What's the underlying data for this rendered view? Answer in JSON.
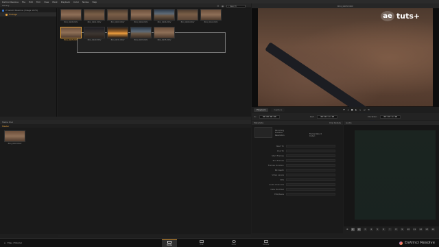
{
  "menubar": {
    "items": [
      "DaVinci Resolve",
      "File",
      "Edit",
      "Trim",
      "View",
      "Mark",
      "Playback",
      "Color",
      "Nodes",
      "Help"
    ]
  },
  "library": {
    "header": "Library",
    "tree": [
      {
        "label": "2 Seoni4 Resolve (Image 1970)",
        "selected": false
      },
      {
        "label": "Footage",
        "selected": true
      }
    ],
    "search_placeholder": "Search",
    "clips_row1": [
      "BV4_0028.MOV",
      "BV4_0001.MOV",
      "BV4_0003.MOV",
      "BV4_0004.MOV",
      "BV4_0006.MOV",
      "BV4_0008.MOV",
      "BV4_0011.MOV"
    ],
    "clips_row2": [
      "BV4_0025.MOV",
      "BV4_0029.MOV",
      "BV4_0031.MOV",
      "BV4_0033.MOV",
      "BV4_0035.MOV"
    ]
  },
  "viewer": {
    "title": "BV4_0005.MOV",
    "tabs": [
      "Playback",
      "Capture"
    ],
    "in_label": "In:",
    "in_tc": "00:00:00:00",
    "out_label": "Out:",
    "out_tc": "00:00:11:00",
    "duration_label": "Duration:",
    "duration_tc": "00:00:11:00",
    "logo_ae": "ae",
    "logo_tuts": "tuts+"
  },
  "media_pool": {
    "header": "Media Pool",
    "bin": "Master",
    "clip_label": "BV4_0005.MOV"
  },
  "metadata": {
    "header": "Metadata",
    "mode": "Clip Details",
    "info": [
      "Recording",
      "Duration",
      "Resolution"
    ],
    "frame_rate_label": "Frame Rate: 0",
    "codec_label": "Codec:",
    "rows": [
      "Start TC",
      "End TC",
      "Start Frames",
      "End Frames",
      "Frames Duration",
      "Bit Depth",
      "Video Levels",
      "VDS",
      "Audio Channels",
      "Date Modified",
      "EDL/Reels"
    ]
  },
  "audio": {
    "header": "Audio",
    "channels": [
      "1",
      "2",
      "3",
      "4",
      "5",
      "6",
      "7",
      "8",
      "9",
      "10",
      "11",
      "12",
      "13",
      "14"
    ]
  },
  "bottombar": {
    "project": "Elias / Tutorial",
    "pages": [
      {
        "label": "Media",
        "active": true
      },
      {
        "label": "Edit",
        "active": false
      },
      {
        "label": "Color",
        "active": false
      },
      {
        "label": "Deliver",
        "active": false
      }
    ],
    "brand": "DaVinci Resolve"
  }
}
